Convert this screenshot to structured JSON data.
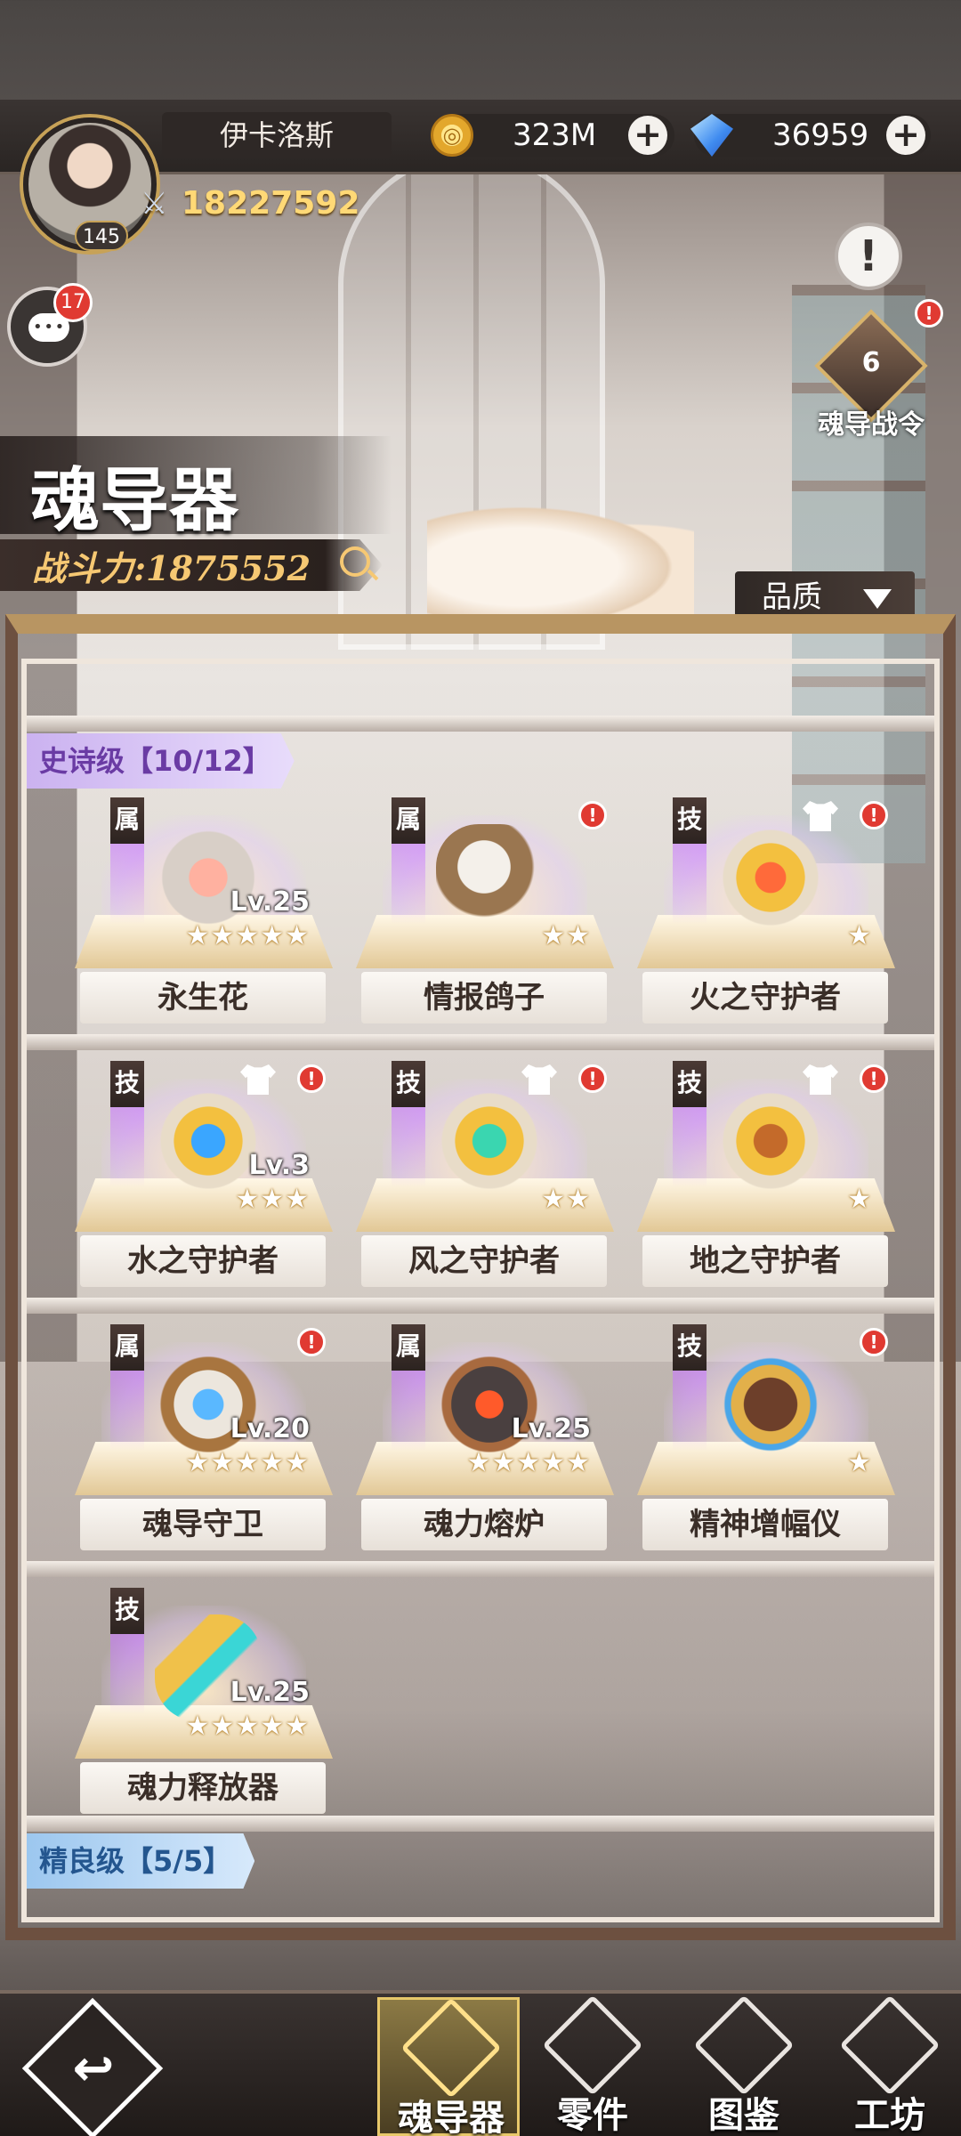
{
  "player": {
    "name": "伊卡洛斯",
    "level": "145",
    "power": "18227592"
  },
  "currency": {
    "gold": "323M",
    "diamonds": "36959",
    "add": "+"
  },
  "chat": {
    "badge": "17"
  },
  "info_button": "!",
  "battle_pass": {
    "level": "6",
    "label": "魂导战令",
    "alert": "!"
  },
  "page": {
    "title": "魂导器",
    "power_label": "战斗力:1875552",
    "filter_label": "品质"
  },
  "tiers": {
    "epic_label": "史诗级【10/12】",
    "fine_label": "精良级【5/5】"
  },
  "items": [
    {
      "name": "永生花",
      "type": "属",
      "level": "Lv.25",
      "stars": "★★★★★",
      "alert": "",
      "equip": false
    },
    {
      "name": "情报鸽子",
      "type": "属",
      "level": "",
      "stars": "★★",
      "alert": "!",
      "equip": false
    },
    {
      "name": "火之守护者",
      "type": "技",
      "level": "",
      "stars": "★",
      "alert": "!",
      "equip": true
    },
    {
      "name": "水之守护者",
      "type": "技",
      "level": "Lv.3",
      "stars": "★★★",
      "alert": "!",
      "equip": true
    },
    {
      "name": "风之守护者",
      "type": "技",
      "level": "",
      "stars": "★★",
      "alert": "!",
      "equip": true
    },
    {
      "name": "地之守护者",
      "type": "技",
      "level": "",
      "stars": "★",
      "alert": "!",
      "equip": true
    },
    {
      "name": "魂导守卫",
      "type": "属",
      "level": "Lv.20",
      "stars": "★★★★★",
      "alert": "!",
      "equip": false
    },
    {
      "name": "魂力熔炉",
      "type": "属",
      "level": "Lv.25",
      "stars": "★★★★★",
      "alert": "",
      "equip": false
    },
    {
      "name": "精神增幅仪",
      "type": "技",
      "level": "",
      "stars": "★",
      "alert": "!",
      "equip": false
    },
    {
      "name": "魂力释放器",
      "type": "技",
      "level": "Lv.25",
      "stars": "★★★★★",
      "alert": "",
      "equip": false
    }
  ],
  "nav": {
    "back_icon": "↩",
    "tabs": [
      {
        "label": "魂导器"
      },
      {
        "label": "零件"
      },
      {
        "label": "图鉴"
      },
      {
        "label": "工坊"
      }
    ]
  },
  "colors": {
    "epic": "#cbb2f0",
    "fine": "#9cc7ef",
    "alert": "#e03a32",
    "gold_text": "#ffd976"
  }
}
